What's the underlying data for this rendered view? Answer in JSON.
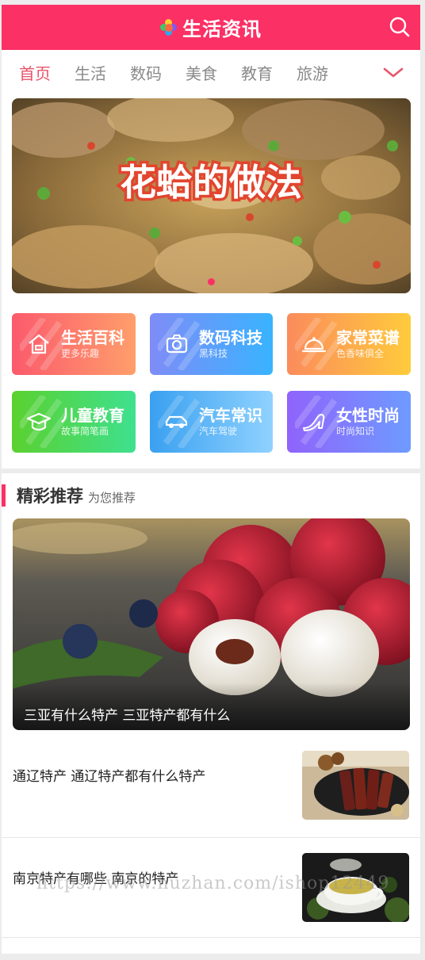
{
  "header": {
    "title": "生活资讯",
    "logo_icon": "colorful-flower-icon",
    "search_icon": "search-icon"
  },
  "nav": {
    "items": [
      {
        "label": "首页",
        "active": true
      },
      {
        "label": "生活",
        "active": false
      },
      {
        "label": "数码",
        "active": false
      },
      {
        "label": "美食",
        "active": false
      },
      {
        "label": "教育",
        "active": false
      },
      {
        "label": "旅游",
        "active": false
      }
    ],
    "more_icon": "chevron-down-icon"
  },
  "banner": {
    "title": "花蛤的做法",
    "slide_count": 1,
    "active_slide": 1
  },
  "categories": [
    {
      "title": "生活百科",
      "subtitle": "更多乐趣",
      "icon": "house-icon",
      "colors": [
        "#fb5a6c",
        "#ff9e6b"
      ]
    },
    {
      "title": "数码科技",
      "subtitle": "黑科技",
      "icon": "camera-icon",
      "colors": [
        "#7f8cf7",
        "#39b3ff"
      ]
    },
    {
      "title": "家常菜谱",
      "subtitle": "色香味俱全",
      "icon": "dish-cover-icon",
      "colors": [
        "#fb8b5c",
        "#ffcb3c"
      ]
    },
    {
      "title": "儿童教育",
      "subtitle": "故事简笔画",
      "icon": "graduation-cap-icon",
      "colors": [
        "#5ad12f",
        "#3fe08f"
      ]
    },
    {
      "title": "汽车常识",
      "subtitle": "汽车驾驶",
      "icon": "car-icon",
      "colors": [
        "#3aa0f0",
        "#8fd2ff"
      ]
    },
    {
      "title": "女性时尚",
      "subtitle": "时尚知识",
      "icon": "high-heel-icon",
      "colors": [
        "#8f63fc",
        "#6e9bff"
      ]
    }
  ],
  "recommend": {
    "title": "精彩推荐",
    "subtitle": "为您推荐",
    "feature": {
      "caption": "三亚有什么特产 三亚特产都有什么"
    },
    "items": [
      {
        "title": "通辽特产 通辽特产都有什么特产"
      },
      {
        "title": "南京特产有哪些 南京的特产"
      }
    ]
  },
  "watermark": "https://www.huzhan.com/ishop12449",
  "colors": {
    "accent": "#fb3065",
    "nav_active": "#e8546a"
  }
}
